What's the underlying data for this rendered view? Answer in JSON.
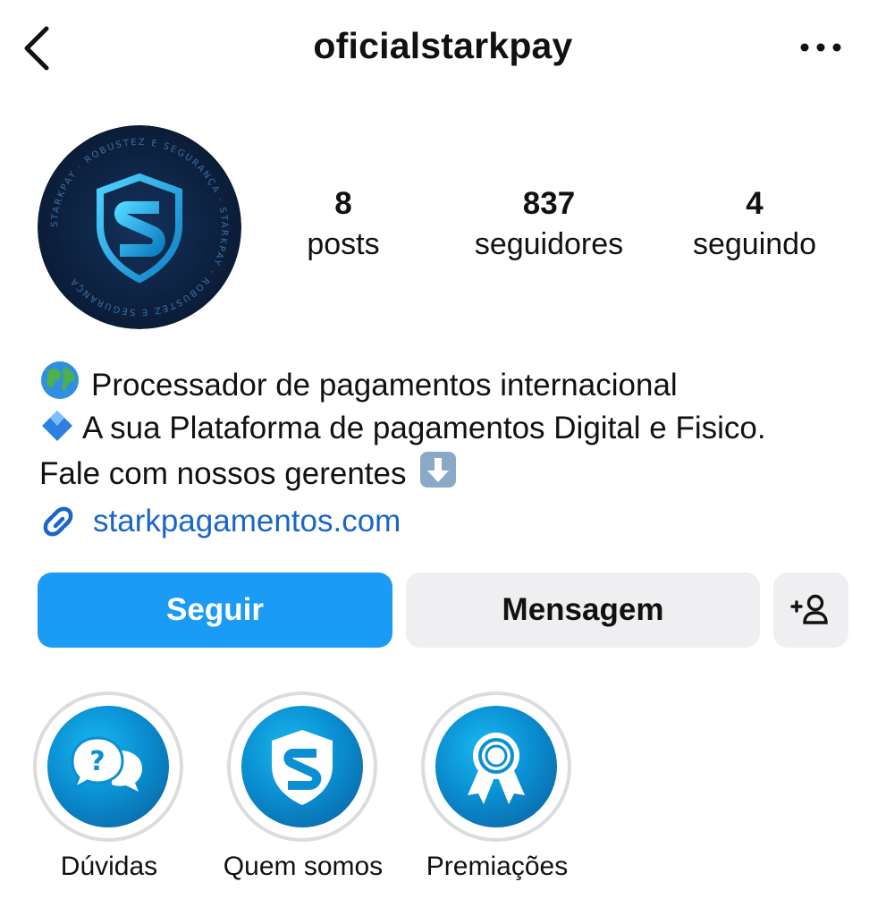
{
  "header": {
    "username": "oficialstarkpay",
    "back_icon": "chevron-left-icon",
    "more_icon": "ellipsis-icon"
  },
  "profile": {
    "avatar_ring_text": "STARKPAY · ROBUSTEZ E SEGURANÇA · STARKPAY · ROBUSTEZ E SEGURANÇA",
    "stats": {
      "posts": {
        "value": "8",
        "label": "posts"
      },
      "followers": {
        "value": "837",
        "label": "seguidores"
      },
      "following": {
        "value": "4",
        "label": "seguindo"
      }
    }
  },
  "bio": {
    "line1_emoji": "globe-icon",
    "line1_text": "Processador de pagamentos internacional",
    "line2_emoji": "blue-diamond-icon",
    "line2_text": "A sua Plataforma de pagamentos Digital e Fisico.",
    "line3_text": "Fale com nossos gerentes",
    "line3_emoji": "down-arrow-icon",
    "link": "starkpagamentos.com"
  },
  "actions": {
    "follow_label": "Seguir",
    "message_label": "Mensagem",
    "add_user_icon": "add-user-icon"
  },
  "highlights": [
    {
      "label": "Dúvidas",
      "icon": "question-bubbles-icon"
    },
    {
      "label": "Quem somos",
      "icon": "shield-s-icon"
    },
    {
      "label": "Premiações",
      "icon": "award-ribbon-icon"
    }
  ],
  "colors": {
    "follow_button": "#1a9bf5",
    "link": "#1a66c8",
    "avatar_bg": "#0c1d38",
    "highlight_blue": "#0a8fd2"
  }
}
